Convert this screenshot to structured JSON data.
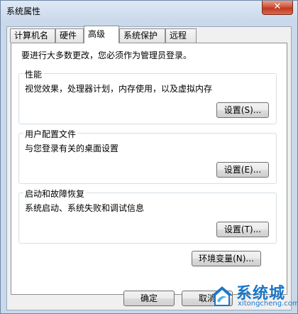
{
  "window": {
    "title": "系统属性",
    "close_label": "✕"
  },
  "tabs": [
    {
      "label": "计算机名",
      "active": false
    },
    {
      "label": "硬件",
      "active": false
    },
    {
      "label": "高级",
      "active": true
    },
    {
      "label": "系统保护",
      "active": false
    },
    {
      "label": "远程",
      "active": false
    }
  ],
  "advanced": {
    "admin_note": "要进行大多数更改，您必须作为管理员登录。",
    "performance": {
      "title": "性能",
      "desc": "视觉效果，处理器计划，内存使用，以及虚拟内存",
      "button": "设置(S)..."
    },
    "user_profiles": {
      "title": "用户配置文件",
      "desc": "与您登录有关的桌面设置",
      "button": "设置(E)..."
    },
    "startup_recovery": {
      "title": "启动和故障恢复",
      "desc": "系统启动、系统失败和调试信息",
      "button": "设置(T)..."
    },
    "env_vars_button": "环境变量(N)..."
  },
  "footer": {
    "ok": "确定",
    "cancel": "取消"
  },
  "watermark": {
    "title": "系统城",
    "url": "xitongcheng.com"
  },
  "colors": {
    "accent": "#1a76c9",
    "close": "#c0381f"
  }
}
